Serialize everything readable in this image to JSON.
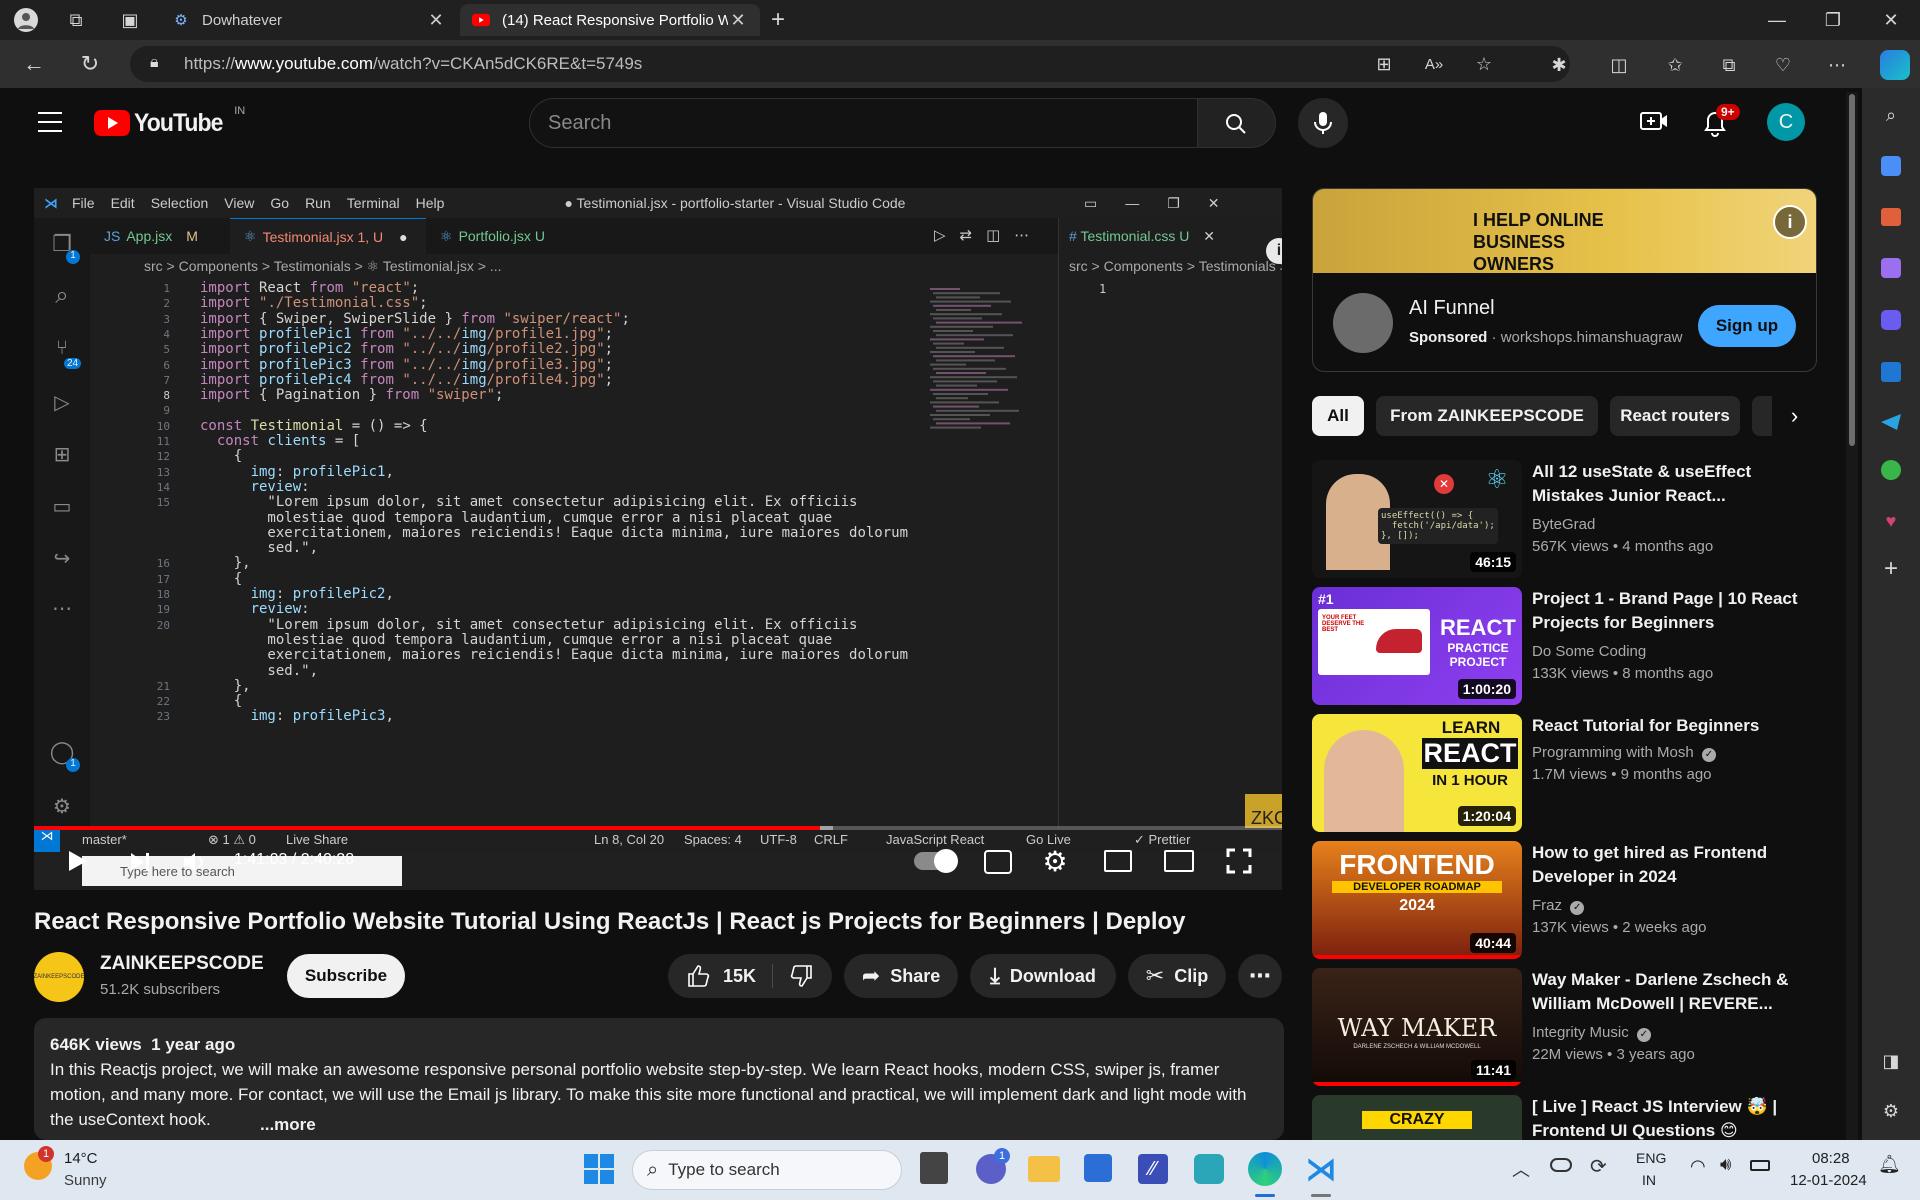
{
  "browser": {
    "tabs": [
      {
        "title": "Dowhatever"
      },
      {
        "title": "(14) React Responsive Portfolio W"
      }
    ],
    "url_prefix": "https://",
    "url_domain": "www.youtube.com",
    "url_rest": "/watch?v=CKAn5dCK6RE&t=5749s"
  },
  "youtube": {
    "logo_text": "YouTube",
    "region": "IN",
    "search_placeholder": "Search",
    "notification_count": "9+",
    "avatar_letter": "C"
  },
  "video": {
    "vscode": {
      "menu": [
        "File",
        "Edit",
        "Selection",
        "View",
        "Go",
        "Run",
        "Terminal",
        "Help"
      ],
      "window_title": "● Testimonial.jsx - portfolio-starter - Visual Studio Code",
      "tabs": [
        {
          "name": "App.jsx",
          "flag": "M"
        },
        {
          "name": "Testimonial.jsx",
          "flag": "1, U"
        },
        {
          "name": "Portfolio.jsx",
          "flag": "U"
        }
      ],
      "right_tab": {
        "name": "Testimonial.css",
        "flag": "U"
      },
      "breadcrumb": "src > Components > Testimonials > ⚛ Testimonial.jsx > ...",
      "right_breadcrumb": "src > Components > Testimonials >",
      "lines": [
        {
          "n": "1",
          "code": "import React from \"react\";"
        },
        {
          "n": "2",
          "code": "import \"./Testimonial.css\";"
        },
        {
          "n": "3",
          "code": "import { Swiper, SwiperSlide } from \"swiper/react\";"
        },
        {
          "n": "4",
          "code": "import profilePic1 from \"../../img/profile1.jpg\";"
        },
        {
          "n": "5",
          "code": "import profilePic2 from \"../../img/profile2.jpg\";"
        },
        {
          "n": "6",
          "code": "import profilePic3 from \"../../img/profile3.jpg\";"
        },
        {
          "n": "7",
          "code": "import profilePic4 from \"../../img/profile4.jpg\";"
        },
        {
          "n": "8",
          "code": "import { Pagination } from \"swiper\";"
        },
        {
          "n": "9",
          "code": ""
        },
        {
          "n": "10",
          "code": "const Testimonial = () => {"
        },
        {
          "n": "11",
          "code": "  const clients = ["
        },
        {
          "n": "12",
          "code": "    {"
        },
        {
          "n": "13",
          "code": "      img: profilePic1,"
        },
        {
          "n": "14",
          "code": "      review:"
        },
        {
          "n": "15",
          "code": "        \"Lorem ipsum dolor, sit amet consectetur adipisicing elit. Ex officiis"
        },
        {
          "n": "",
          "code": "        molestiae quod tempora laudantium, cumque error a nisi placeat quae"
        },
        {
          "n": "",
          "code": "        exercitationem, maiores reiciendis! Eaque dicta minima, iure maiores dolorum"
        },
        {
          "n": "",
          "code": "        sed.\","
        },
        {
          "n": "16",
          "code": "    },"
        },
        {
          "n": "17",
          "code": "    {"
        },
        {
          "n": "18",
          "code": "      img: profilePic2,"
        },
        {
          "n": "19",
          "code": "      review:"
        },
        {
          "n": "20",
          "code": "        \"Lorem ipsum dolor, sit amet consectetur adipisicing elit. Ex officiis"
        },
        {
          "n": "",
          "code": "        molestiae quod tempora laudantium, cumque error a nisi placeat quae"
        },
        {
          "n": "",
          "code": "        exercitationem, maiores reiciendis! Eaque dicta minima, iure maiores dolorum"
        },
        {
          "n": "",
          "code": "        sed.\","
        },
        {
          "n": "21",
          "code": "    },"
        },
        {
          "n": "22",
          "code": "    {"
        },
        {
          "n": "23",
          "code": "      img: profilePic3,"
        }
      ],
      "status": {
        "branch": "master*",
        "problems": "⊗ 1 ⚠ 0",
        "live_share": "Live Share",
        "position": "Ln 8, Col 20",
        "spaces": "Spaces: 4",
        "encoding": "UTF-8",
        "eol": "CRLF",
        "language": "JavaScript React",
        "go_live": "Go Live",
        "prettier": "✓ Prettier"
      },
      "activity_badges": {
        "explorer": "1",
        "scm": "24",
        "account": "1"
      },
      "inner_taskbar_search": "Type here to search",
      "watermark": "ZKC",
      "right_editor_line": "1"
    },
    "time": "1:41:03 / 2:40:28",
    "progress_played": 0.63,
    "progress_loaded": 0.64,
    "title": "React Responsive Portfolio Website Tutorial Using ReactJs | React js Projects for Beginners | Deploy"
  },
  "channel": {
    "name": "ZAINKEEPSCODE",
    "subscribers": "51.2K subscribers",
    "subscribe_label": "Subscribe",
    "avatar_text": "ZAINKEEPSCODE"
  },
  "actions": {
    "likes": "15K",
    "share": "Share",
    "download": "Download",
    "clip": "Clip"
  },
  "description": {
    "views": "646K views",
    "age": "1 year ago",
    "text": "In this Reactjs project, we will make an awesome responsive personal portfolio website step-by-step. We learn React hooks, modern CSS, swiper js, framer motion, and many more. For contact, we will use the Email js library. To make this site more functional and practical, we will implement dark and light mode with the useContext hook.",
    "more": "...more"
  },
  "ad": {
    "banner_text": "I HELP ONLINE BUSINESS OWNERS",
    "title": "AI Funnel",
    "sponsored": "Sponsored",
    "domain": "workshops.himanshuagraw",
    "cta": "Sign up"
  },
  "chips": [
    "All",
    "From ZAINKEEPSCODE",
    "React routers"
  ],
  "recommendations": [
    {
      "title": "All 12 useState & useEffect Mistakes Junior React...",
      "channel": "ByteGrad",
      "verified": false,
      "meta": "567K views • 4 months ago",
      "duration": "46:15",
      "thumb_code": "useEffect(() => {\n  fetch('/api/data');\n}, []);"
    },
    {
      "title": "Project 1 - Brand Page | 10 React Projects for Beginners",
      "channel": "Do Some Coding",
      "verified": false,
      "meta": "133K views • 8 months ago",
      "duration": "1:00:20",
      "thumb_tag": "#1",
      "thumb_big": "REACT",
      "thumb_small": "PRACTICE PROJECT",
      "thumb_note": "YOUR FEET DESERVE THE BEST"
    },
    {
      "title": "React Tutorial for Beginners",
      "channel": "Programming with Mosh",
      "verified": true,
      "meta": "1.7M views • 9 months ago",
      "duration": "1:20:04",
      "thumb_l1": "LEARN",
      "thumb_l2": "REACT",
      "thumb_l3": "IN 1 HOUR"
    },
    {
      "title": "How to get hired as Frontend Developer in 2024",
      "channel": "Fraz",
      "verified": true,
      "meta": "137K views • 2 weeks ago",
      "duration": "40:44",
      "thumb_l1": "FRONTEND",
      "thumb_l2": "DEVELOPER ROADMAP",
      "thumb_l3": "2024"
    },
    {
      "title": "Way Maker - Darlene Zschech & William McDowell | REVERE...",
      "channel": "Integrity Music",
      "verified": true,
      "meta": "22M views • 3 years ago",
      "duration": "11:41",
      "thumb_l1": "WAY MAKER",
      "thumb_l2": "DARLENE ZSCHECH & WILLIAM MCDOWELL"
    },
    {
      "title": "[ Live ] React JS Interview 🤯 | Frontend UI Questions 😊",
      "channel": "",
      "verified": false,
      "meta": "",
      "duration": "",
      "thumb_l1": "CRAZY"
    }
  ],
  "taskbar": {
    "weather_temp": "14°C",
    "weather_desc": "Sunny",
    "weather_badge": "1",
    "search_placeholder": "Type to search",
    "lang_top": "ENG",
    "lang_bottom": "IN",
    "time": "08:28",
    "date": "12-01-2024",
    "chat_badge": "1"
  },
  "colors": {
    "yt_red": "#ff0000",
    "accent_blue": "#3ea6ff",
    "vscode_bg": "#1e1e1e",
    "background": "#0f0f0f"
  }
}
